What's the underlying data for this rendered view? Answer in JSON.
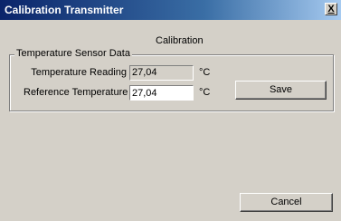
{
  "window": {
    "title": "Calibration Transmitter",
    "close_label": "X"
  },
  "heading": "Calibration",
  "group": {
    "legend": "Temperature Sensor Data",
    "temperature_reading": {
      "label": "Temperature Reading",
      "value": "27,04",
      "unit": "°C"
    },
    "reference_temperature": {
      "label": "Reference Temperature",
      "value": "27,04",
      "unit": "°C"
    }
  },
  "buttons": {
    "save_label": "Save",
    "cancel_label": "Cancel"
  }
}
